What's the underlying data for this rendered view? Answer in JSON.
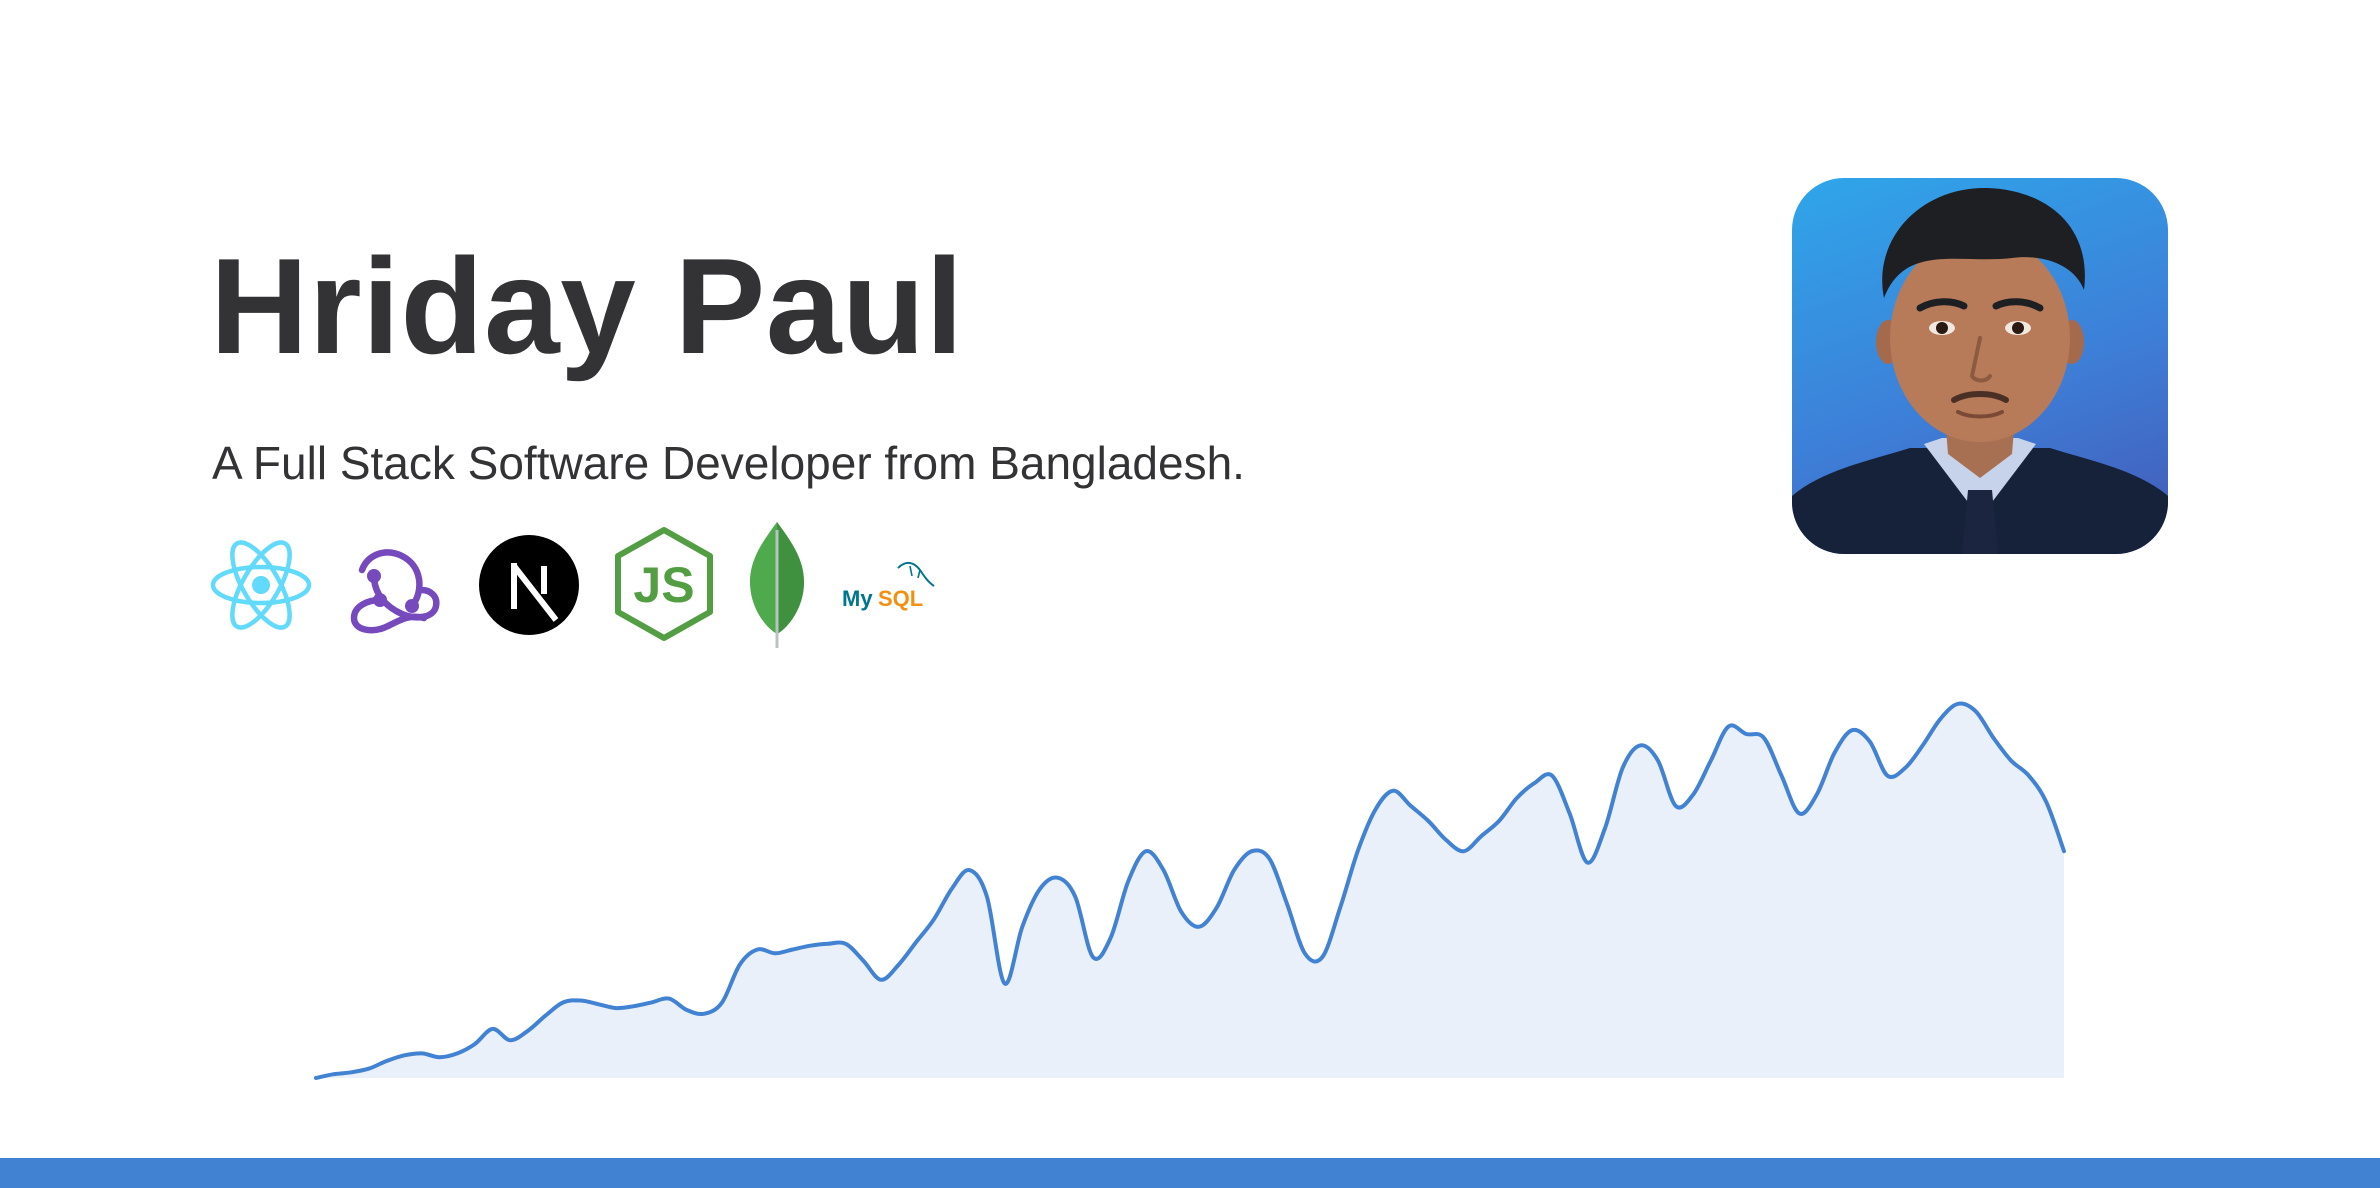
{
  "profile": {
    "name": "Hriday Paul",
    "tagline": "A Full Stack Software Developer from Bangladesh."
  },
  "tech_stack": [
    {
      "name": "React",
      "icon": "react-icon",
      "color": "#61dafb"
    },
    {
      "name": "Redux",
      "icon": "redux-icon",
      "color": "#764abc"
    },
    {
      "name": "Next.js",
      "icon": "nextjs-icon",
      "color": "#000000"
    },
    {
      "name": "Node.js",
      "icon": "nodejs-icon",
      "color": "#539e43"
    },
    {
      "name": "MongoDB",
      "icon": "mongodb-icon",
      "color": "#4fa94d"
    },
    {
      "name": "MySQL",
      "icon": "mysql-icon",
      "color": "#00758f",
      "label_my": "My",
      "label_sql": "SQL"
    }
  ],
  "avatar": {
    "icon": "profile-photo",
    "background": "#3b8fe0"
  },
  "theme": {
    "accent": "#4282d3",
    "text": "#333336",
    "area_fill": "#eaf0f9"
  },
  "chart_data": {
    "type": "line",
    "area_fill": true,
    "grid": false,
    "xlabel": "",
    "ylabel": "",
    "ylim": [
      0,
      100
    ],
    "x": [
      0,
      1,
      2,
      3,
      4,
      5,
      6,
      7,
      8,
      9,
      10,
      11,
      12,
      13,
      14,
      15,
      16,
      17,
      18,
      19,
      20,
      21,
      22,
      23,
      24,
      25,
      26,
      27,
      28,
      29,
      30,
      31,
      32,
      33,
      34,
      35,
      36,
      37,
      38,
      39,
      40,
      41,
      42,
      43,
      44,
      45,
      46,
      47,
      48,
      49,
      50,
      51,
      52,
      53,
      54,
      55,
      56,
      57,
      58,
      59,
      60,
      61,
      62,
      63,
      64,
      65,
      66,
      67,
      68,
      69,
      70,
      71,
      72,
      73,
      74,
      75,
      76,
      77,
      78,
      79,
      80,
      81,
      82,
      83,
      84,
      85,
      86,
      87,
      88,
      89,
      90,
      91,
      92,
      93,
      94,
      95,
      96,
      97,
      98,
      99
    ],
    "values": [
      0,
      1,
      1.5,
      2.5,
      4.5,
      6,
      6.5,
      5.5,
      6.5,
      9,
      13,
      10,
      12.5,
      16.5,
      20,
      20.5,
      19.5,
      18.5,
      19,
      20,
      21,
      18,
      17,
      20,
      30,
      34,
      33,
      34,
      35,
      35.5,
      35.5,
      31,
      26,
      30,
      36,
      42,
      50,
      55,
      48,
      25,
      40,
      50,
      53,
      48,
      32,
      37,
      52,
      60,
      55,
      44,
      40,
      45,
      55,
      60,
      58,
      46,
      33,
      32,
      45,
      60,
      71,
      76,
      72,
      68,
      63,
      60,
      64,
      68,
      74,
      78,
      80,
      70,
      57,
      66,
      82,
      88,
      84,
      72,
      75,
      84,
      93,
      91,
      90,
      80,
      70,
      75,
      86,
      92,
      89,
      80,
      82,
      88,
      95,
      99,
      97,
      90,
      84,
      80,
      73,
      60
    ],
    "series": [
      {
        "values_ref": "values",
        "color": "#4282d3"
      }
    ]
  }
}
